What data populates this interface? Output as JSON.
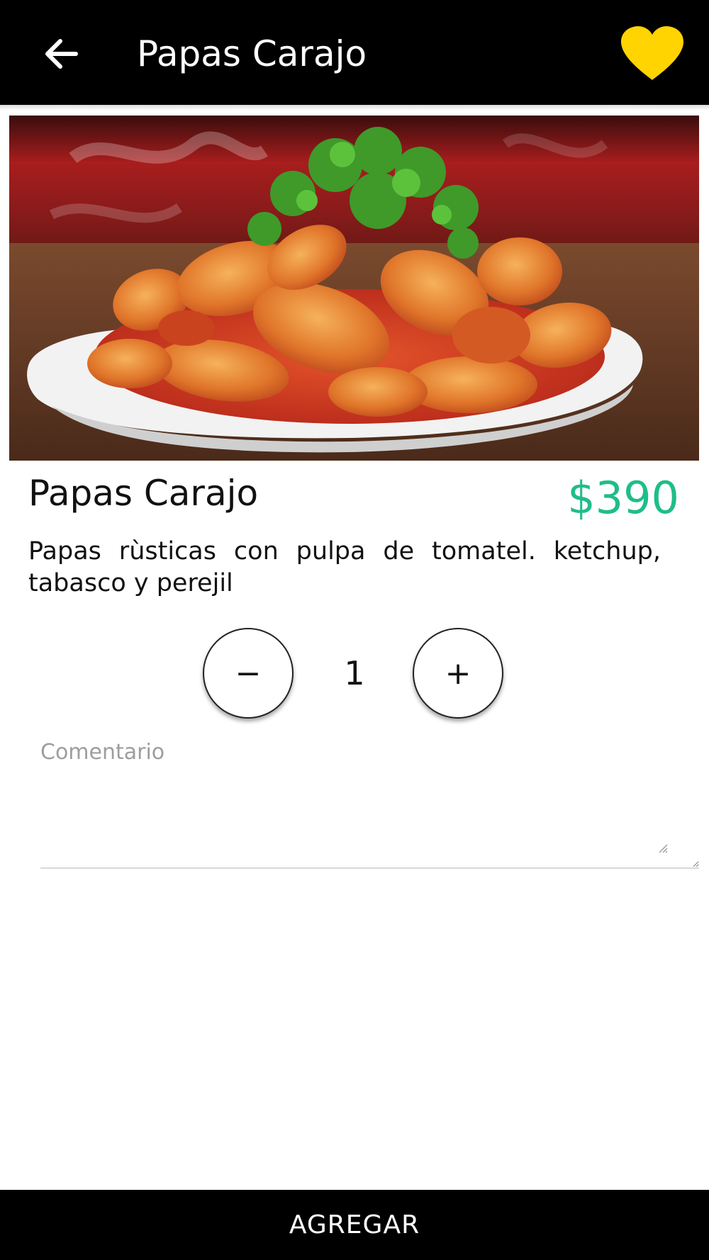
{
  "header": {
    "title": "Papas Carajo",
    "back_icon": "arrow-left-icon",
    "favorite_icon": "heart-icon",
    "favorite_color": "#ffd400",
    "background": "#000000"
  },
  "product": {
    "image_icon": "food-photo",
    "name": "Papas Carajo",
    "price": "$390",
    "price_color": "#1fbd8a",
    "description": "Papas rùsticas con pulpa de tomatel. ketchup, tabasco y perejil"
  },
  "quantity": {
    "minus_label": "−",
    "value": "1",
    "plus_label": "+"
  },
  "comment": {
    "label": "Comentario",
    "value": ""
  },
  "footer": {
    "add_label": "AGREGAR"
  }
}
